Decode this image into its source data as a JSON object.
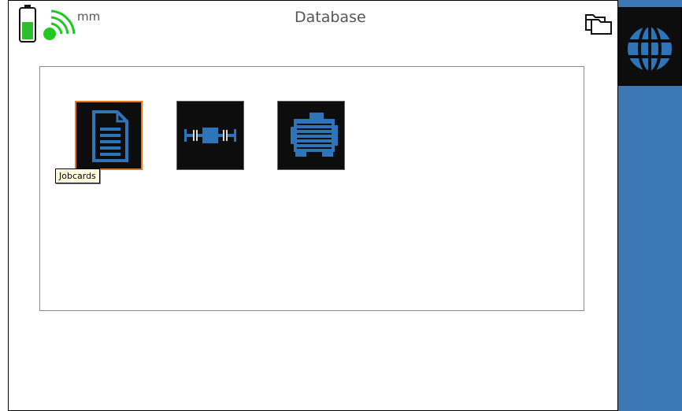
{
  "header": {
    "title": "Database",
    "unit": "mm",
    "battery_level": 0.55,
    "signal_connected": true
  },
  "colors": {
    "battery_green": "#2dbd2d",
    "signal_green": "#22c822",
    "sidebar_blue": "#3c79b4",
    "icon_blue": "#2e74b8",
    "selection_orange": "#e07a1a"
  },
  "tiles": [
    {
      "icon": "document-icon",
      "tooltip": "Jobcards",
      "selected": true
    },
    {
      "icon": "shaft-coupling-icon",
      "selected": false
    },
    {
      "icon": "motor-icon",
      "selected": false
    }
  ],
  "sidebar": {
    "icon": "globe-icon"
  }
}
